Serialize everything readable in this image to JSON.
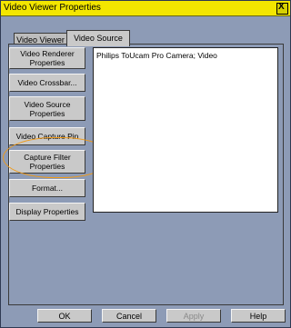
{
  "window": {
    "title": "Video Viewer Properties",
    "close_label": "X"
  },
  "tabs": [
    {
      "label": "Video Viewer"
    },
    {
      "label": "Video Source"
    }
  ],
  "left_buttons": [
    {
      "label": "Video Renderer Properties"
    },
    {
      "label": "Video Crossbar..."
    },
    {
      "label": "Video Source Properties"
    },
    {
      "label": "Video Capture Pin"
    },
    {
      "label": "Capture Filter Properties"
    },
    {
      "label": "Format..."
    },
    {
      "label": "Display Properties"
    }
  ],
  "device_list": {
    "items": [
      "Philips ToUcam Pro Camera; Video"
    ]
  },
  "footer": {
    "ok": "OK",
    "cancel": "Cancel",
    "apply": "Apply",
    "help": "Help"
  }
}
